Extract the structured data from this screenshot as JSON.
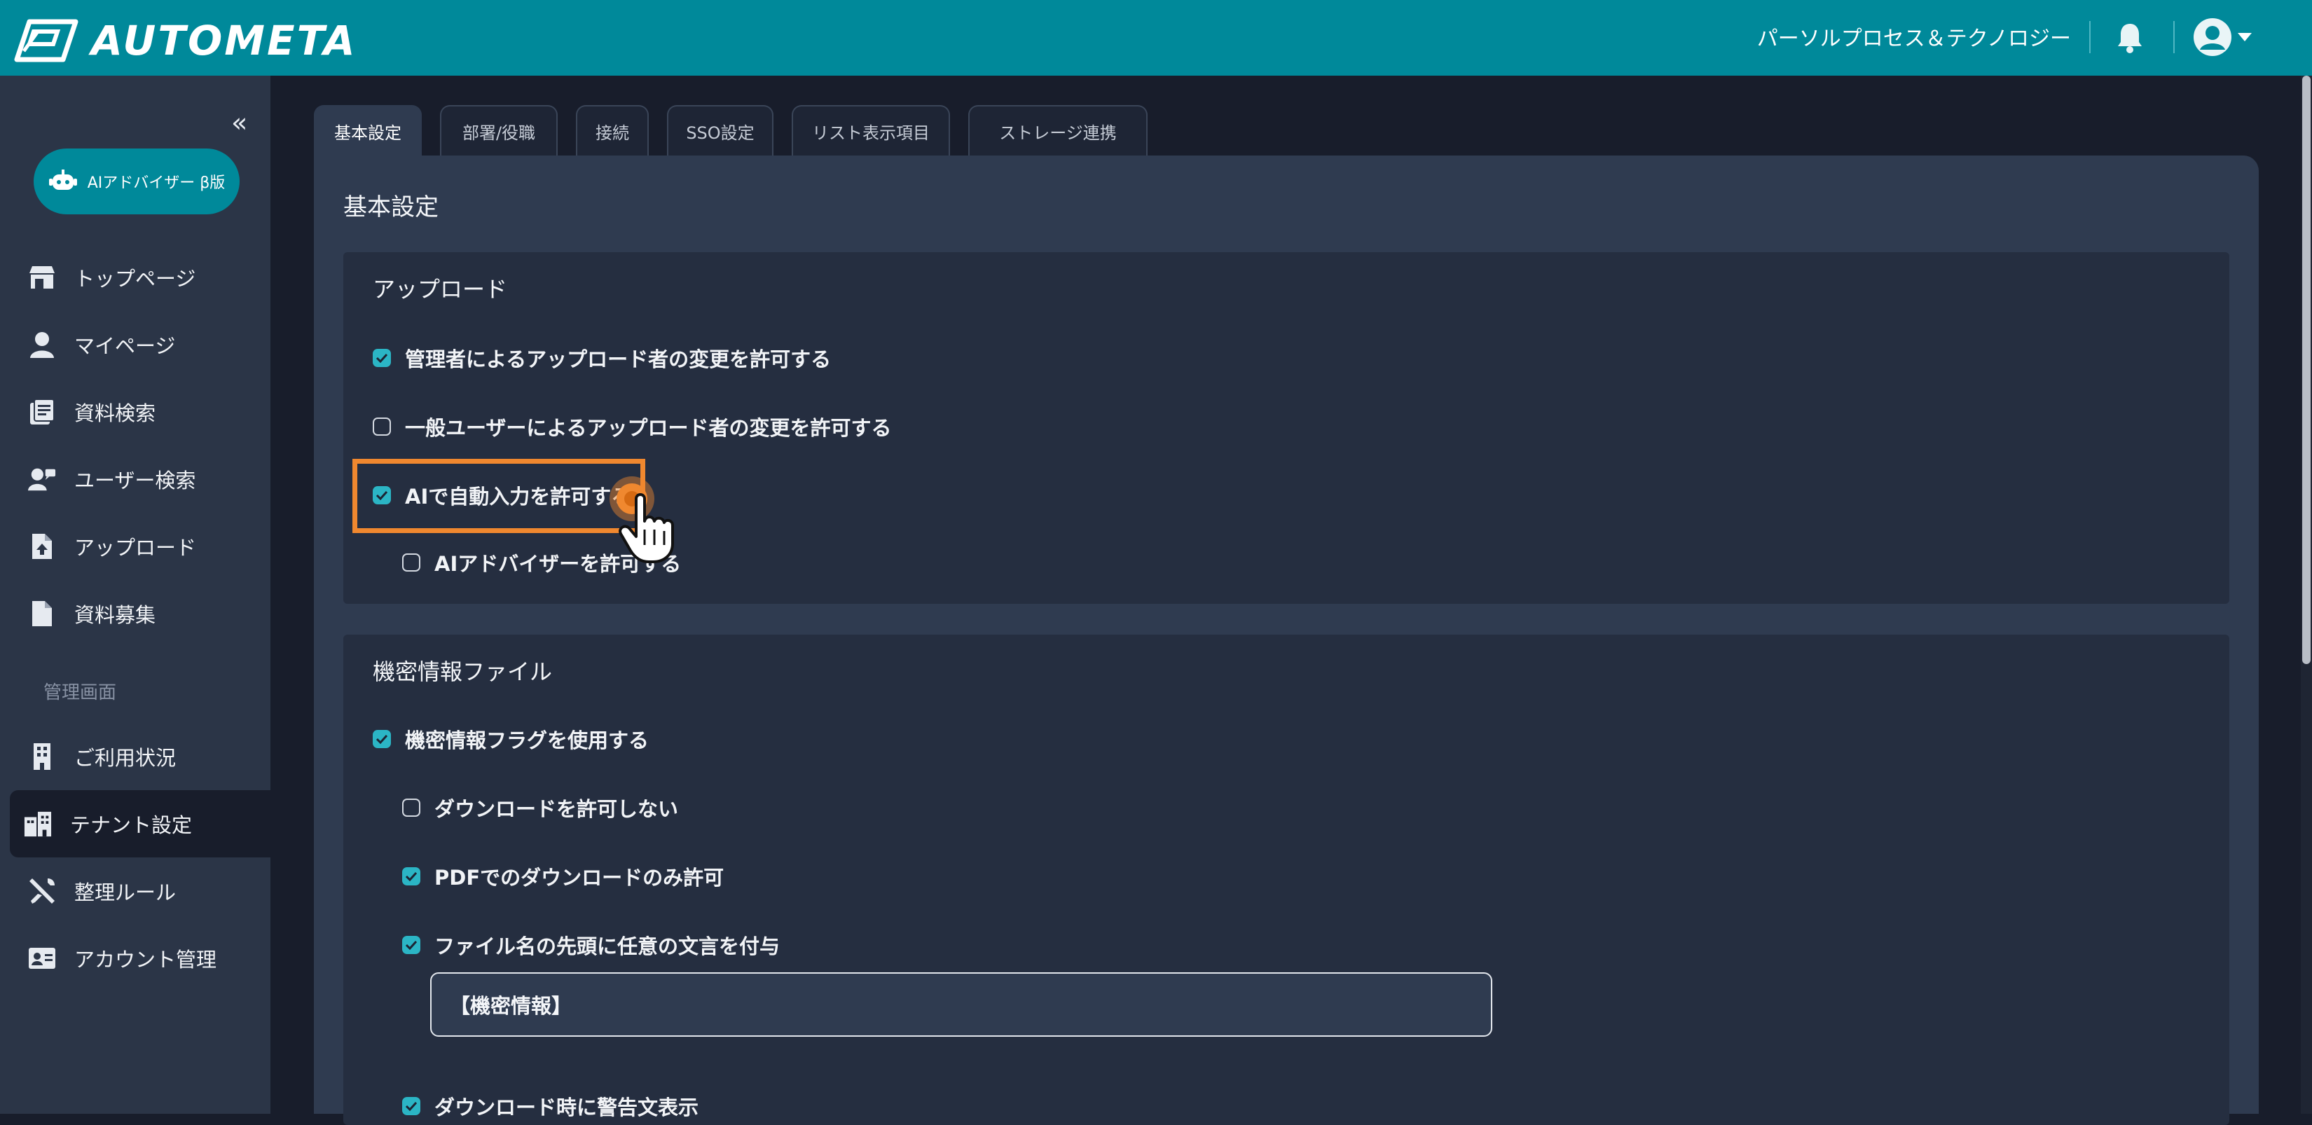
{
  "header": {
    "logo_text": "AUTOMETA",
    "org_name": "パーソルプロセス＆テクノロジー",
    "brand_color": "#00899a"
  },
  "sidebar": {
    "ai_button_label": "AIアドバイザー β版",
    "items": [
      {
        "label": "トップページ",
        "icon": "store-icon"
      },
      {
        "label": "マイページ",
        "icon": "user-icon"
      },
      {
        "label": "資料検索",
        "icon": "document-list-icon"
      },
      {
        "label": "ユーザー検索",
        "icon": "user-search-icon"
      },
      {
        "label": "アップロード",
        "icon": "file-upload-icon"
      },
      {
        "label": "資料募集",
        "icon": "file-icon"
      }
    ],
    "admin_section_label": "管理画面",
    "admin_items": [
      {
        "label": "ご利用状況",
        "icon": "building-icon"
      },
      {
        "label": "テナント設定",
        "icon": "tenant-building-icon",
        "active": true
      },
      {
        "label": "整理ルール",
        "icon": "tools-icon"
      },
      {
        "label": "アカウント管理",
        "icon": "id-card-icon"
      }
    ]
  },
  "tabs": [
    {
      "label": "基本設定",
      "active": true
    },
    {
      "label": "部署/役職"
    },
    {
      "label": "接続"
    },
    {
      "label": "SSO設定"
    },
    {
      "label": "リスト表示項目"
    },
    {
      "label": "ストレージ連携"
    }
  ],
  "main": {
    "title": "基本設定",
    "upload_section": {
      "title": "アップロード",
      "options": [
        {
          "label": "管理者によるアップロード者の変更を許可する",
          "checked": true
        },
        {
          "label": "一般ユーザーによるアップロード者の変更を許可する",
          "checked": false
        },
        {
          "label": "AIで自動入力を許可する",
          "checked": true
        },
        {
          "label": "AIアドバイザーを許可する",
          "checked": false
        }
      ]
    },
    "confidential_section": {
      "title": "機密情報ファイル",
      "options": [
        {
          "label": "機密情報フラグを使用する",
          "checked": true
        },
        {
          "label": "ダウンロードを許可しない",
          "checked": false
        },
        {
          "label": "PDFでのダウンロードのみ許可",
          "checked": true
        },
        {
          "label": "ファイル名の先頭に任意の文言を付与",
          "checked": true
        },
        {
          "label": "ダウンロード時に警告文表示",
          "checked": true
        }
      ],
      "prefix_value": "【機密情報】"
    }
  },
  "colors": {
    "accent": "#2bb5c5",
    "highlight": "#f0882f"
  }
}
